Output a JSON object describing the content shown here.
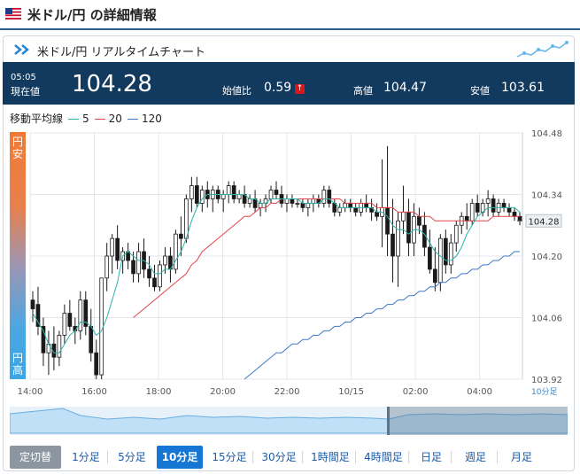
{
  "header": {
    "title": "米ドル/円 の詳細情報",
    "flag_icon": "us-flag-icon"
  },
  "panel": {
    "title": "米ドル/円 リアルタイムチャート"
  },
  "quote": {
    "time": "05:05",
    "time_label": "現在値",
    "price": "104.28",
    "change_label": "始値比",
    "change": "0.59",
    "high_label": "高値",
    "high": "104.47",
    "low_label": "安値",
    "low": "103.61"
  },
  "side": {
    "top": "円安",
    "bottom": "円高"
  },
  "legend": {
    "label": "移動平均線",
    "items": [
      {
        "label": "5",
        "color": "#2ab3a6"
      },
      {
        "label": "20",
        "color": "#e0444a"
      },
      {
        "label": "120",
        "color": "#3a79c9"
      }
    ]
  },
  "chart_data": {
    "type": "candlestick",
    "x_ticks": [
      "14:00",
      "16:00",
      "18:00",
      "20:00",
      "22:00",
      "10/15",
      "02:00",
      "04:00"
    ],
    "x_unit": "10分足",
    "ylim": [
      103.92,
      104.48
    ],
    "y_ticks": [
      "104.48",
      "104.34",
      "104.20",
      "104.06",
      "103.92"
    ],
    "current_price_label": "104.28",
    "grid": true,
    "colors": {
      "up": "#ffffff",
      "down": "#1a1a1a",
      "ma5": "#2ab3a6",
      "ma20": "#e0444a",
      "ma120": "#3a79c9"
    },
    "candles": [
      [
        104.1,
        104.12,
        104.05,
        104.08
      ],
      [
        104.09,
        104.13,
        104.02,
        104.04
      ],
      [
        104.04,
        104.06,
        103.95,
        103.98
      ],
      [
        103.98,
        104.03,
        103.93,
        104.0
      ],
      [
        104.0,
        104.04,
        103.94,
        103.97
      ],
      [
        103.97,
        104.03,
        103.95,
        104.02
      ],
      [
        104.02,
        104.09,
        104.0,
        104.07
      ],
      [
        104.07,
        104.1,
        104.03,
        104.04
      ],
      [
        104.04,
        104.06,
        104.0,
        104.03
      ],
      [
        104.03,
        104.12,
        104.01,
        104.1
      ],
      [
        104.1,
        104.12,
        104.02,
        104.04
      ],
      [
        104.04,
        104.08,
        103.96,
        103.98
      ],
      [
        103.98,
        104.01,
        103.92,
        103.93
      ],
      [
        103.93,
        104.15,
        103.92,
        104.15
      ],
      [
        104.15,
        104.23,
        104.12,
        104.2
      ],
      [
        104.2,
        104.25,
        104.16,
        104.24
      ],
      [
        104.24,
        104.27,
        104.17,
        104.19
      ],
      [
        104.19,
        104.22,
        104.16,
        104.21
      ],
      [
        104.21,
        104.23,
        104.17,
        104.19
      ],
      [
        104.19,
        104.21,
        104.14,
        104.16
      ],
      [
        104.16,
        104.23,
        104.14,
        104.21
      ],
      [
        104.21,
        104.24,
        104.15,
        104.17
      ],
      [
        104.17,
        104.2,
        104.13,
        104.15
      ],
      [
        104.15,
        104.18,
        104.12,
        104.13
      ],
      [
        104.13,
        104.19,
        104.12,
        104.18
      ],
      [
        104.18,
        104.22,
        104.16,
        104.2
      ],
      [
        104.2,
        104.22,
        104.14,
        104.17
      ],
      [
        104.17,
        104.26,
        104.16,
        104.25
      ],
      [
        104.25,
        104.29,
        104.2,
        104.24
      ],
      [
        104.24,
        104.34,
        104.23,
        104.33
      ],
      [
        104.33,
        104.38,
        104.3,
        104.36
      ],
      [
        104.36,
        104.38,
        104.31,
        104.32
      ],
      [
        104.32,
        104.36,
        104.3,
        104.35
      ],
      [
        104.35,
        104.37,
        104.31,
        104.33
      ],
      [
        104.33,
        104.36,
        104.3,
        104.35
      ],
      [
        104.35,
        104.36,
        104.32,
        104.33
      ],
      [
        104.33,
        104.35,
        104.3,
        104.34
      ],
      [
        104.34,
        104.37,
        104.32,
        104.36
      ],
      [
        104.36,
        104.37,
        104.32,
        104.33
      ],
      [
        104.33,
        104.35,
        104.32,
        104.34
      ],
      [
        104.34,
        104.36,
        104.31,
        104.32
      ],
      [
        104.32,
        104.34,
        104.31,
        104.33
      ],
      [
        104.33,
        104.35,
        104.3,
        104.31
      ],
      [
        104.31,
        104.33,
        104.29,
        104.32
      ],
      [
        104.32,
        104.34,
        104.3,
        104.33
      ],
      [
        104.33,
        104.36,
        104.32,
        104.35
      ],
      [
        104.35,
        104.37,
        104.33,
        104.34
      ],
      [
        104.34,
        104.36,
        104.31,
        104.32
      ],
      [
        104.32,
        104.34,
        104.3,
        104.33
      ],
      [
        104.33,
        104.34,
        104.31,
        104.32
      ],
      [
        104.32,
        104.33,
        104.31,
        104.32
      ],
      [
        104.32,
        104.33,
        104.3,
        104.31
      ],
      [
        104.31,
        104.33,
        104.29,
        104.32
      ],
      [
        104.32,
        104.34,
        104.3,
        104.33
      ],
      [
        104.33,
        104.34,
        104.31,
        104.32
      ],
      [
        104.32,
        104.36,
        104.31,
        104.35
      ],
      [
        104.35,
        104.36,
        104.31,
        104.32
      ],
      [
        104.32,
        104.33,
        104.29,
        104.3
      ],
      [
        104.3,
        104.32,
        104.29,
        104.31
      ],
      [
        104.31,
        104.33,
        104.3,
        104.32
      ],
      [
        104.32,
        104.33,
        104.3,
        104.31
      ],
      [
        104.31,
        104.32,
        104.29,
        104.3
      ],
      [
        104.3,
        104.33,
        104.29,
        104.32
      ],
      [
        104.32,
        104.34,
        104.3,
        104.31
      ],
      [
        104.31,
        104.33,
        104.28,
        104.3
      ],
      [
        104.3,
        104.32,
        104.28,
        104.29
      ],
      [
        104.29,
        104.42,
        104.22,
        104.31
      ],
      [
        104.31,
        104.45,
        104.2,
        104.25
      ],
      [
        104.25,
        104.33,
        104.14,
        104.2
      ],
      [
        104.2,
        104.3,
        104.13,
        104.28
      ],
      [
        104.28,
        104.36,
        104.25,
        104.3
      ],
      [
        104.3,
        104.33,
        104.2,
        104.23
      ],
      [
        104.23,
        104.32,
        104.2,
        104.29
      ],
      [
        104.29,
        104.31,
        104.25,
        104.27
      ],
      [
        104.27,
        104.3,
        104.2,
        104.22
      ],
      [
        104.22,
        104.26,
        104.16,
        104.17
      ],
      [
        104.17,
        104.22,
        104.12,
        104.14
      ],
      [
        104.14,
        104.25,
        104.12,
        104.24
      ],
      [
        104.24,
        104.26,
        104.16,
        104.18
      ],
      [
        104.18,
        104.25,
        104.16,
        104.23
      ],
      [
        104.23,
        104.28,
        104.21,
        104.27
      ],
      [
        104.27,
        104.3,
        104.25,
        104.29
      ],
      [
        104.29,
        104.32,
        104.26,
        104.28
      ],
      [
        104.28,
        104.33,
        104.27,
        104.32
      ],
      [
        104.32,
        104.34,
        104.29,
        104.3
      ],
      [
        104.3,
        104.33,
        104.29,
        104.32
      ],
      [
        104.32,
        104.35,
        104.29,
        104.33
      ],
      [
        104.33,
        104.34,
        104.29,
        104.3
      ],
      [
        104.3,
        104.33,
        104.29,
        104.32
      ],
      [
        104.32,
        104.33,
        104.3,
        104.31
      ],
      [
        104.31,
        104.32,
        104.29,
        104.3
      ],
      [
        104.3,
        104.31,
        104.28,
        104.29
      ],
      [
        104.29,
        104.3,
        104.27,
        104.28
      ]
    ],
    "ma5": [
      104.07,
      104.05,
      104.03,
      104.0,
      103.98,
      103.98,
      104.0,
      104.02,
      104.03,
      104.05,
      104.05,
      104.04,
      104.02,
      104.03,
      104.06,
      104.1,
      104.14,
      104.2,
      104.21,
      104.2,
      104.19,
      104.19,
      104.18,
      104.16,
      104.16,
      104.17,
      104.17,
      104.19,
      104.21,
      104.24,
      104.28,
      104.31,
      104.33,
      104.34,
      104.34,
      104.34,
      104.34,
      104.34,
      104.34,
      104.34,
      104.34,
      104.33,
      104.33,
      104.32,
      104.32,
      104.33,
      104.33,
      104.33,
      104.33,
      104.33,
      104.33,
      104.32,
      104.32,
      104.32,
      104.32,
      104.33,
      104.33,
      104.32,
      104.31,
      104.31,
      104.31,
      104.31,
      104.31,
      104.31,
      104.31,
      104.3,
      104.3,
      104.29,
      104.27,
      104.26,
      104.26,
      104.25,
      104.26,
      104.26,
      104.25,
      104.23,
      104.21,
      104.2,
      104.19,
      104.19,
      104.2,
      104.22,
      104.25,
      104.27,
      104.29,
      104.3,
      104.31,
      104.31,
      104.31,
      104.31,
      104.31,
      104.31,
      104.3
    ],
    "ma20": [
      null,
      null,
      null,
      null,
      null,
      null,
      null,
      null,
      null,
      null,
      null,
      null,
      null,
      null,
      null,
      null,
      null,
      null,
      null,
      104.06,
      104.07,
      104.08,
      104.09,
      104.1,
      104.11,
      104.12,
      104.13,
      104.14,
      104.15,
      104.16,
      104.18,
      104.19,
      104.21,
      104.22,
      104.23,
      104.24,
      104.25,
      104.26,
      104.27,
      104.28,
      104.29,
      104.29,
      104.3,
      104.31,
      104.31,
      104.32,
      104.32,
      104.33,
      104.33,
      104.33,
      104.33,
      104.33,
      104.33,
      104.33,
      104.33,
      104.33,
      104.33,
      104.33,
      104.33,
      104.32,
      104.32,
      104.32,
      104.32,
      104.32,
      104.32,
      104.31,
      104.31,
      104.31,
      104.31,
      104.3,
      104.3,
      104.3,
      104.3,
      104.29,
      104.29,
      104.29,
      104.28,
      104.28,
      104.28,
      104.28,
      104.28,
      104.28,
      104.28,
      104.28,
      104.28,
      104.28,
      104.28,
      104.29,
      104.29,
      104.29,
      104.29,
      104.29,
      104.29
    ],
    "ma120": [
      null,
      null,
      null,
      null,
      null,
      null,
      null,
      null,
      null,
      null,
      null,
      null,
      null,
      null,
      null,
      null,
      null,
      null,
      null,
      null,
      null,
      null,
      null,
      null,
      null,
      null,
      null,
      null,
      null,
      null,
      null,
      null,
      null,
      null,
      null,
      null,
      null,
      null,
      null,
      null,
      103.92,
      103.93,
      103.94,
      103.95,
      103.96,
      103.97,
      103.98,
      103.98,
      103.99,
      104.0,
      104.0,
      104.01,
      104.01,
      104.02,
      104.02,
      104.03,
      104.03,
      104.04,
      104.04,
      104.05,
      104.05,
      104.06,
      104.06,
      104.07,
      104.07,
      104.08,
      104.08,
      104.09,
      104.09,
      104.1,
      104.1,
      104.11,
      104.11,
      104.12,
      104.12,
      104.13,
      104.13,
      104.14,
      104.14,
      104.15,
      104.15,
      104.16,
      104.16,
      104.17,
      104.17,
      104.18,
      104.18,
      104.19,
      104.19,
      104.2,
      104.2,
      104.21,
      104.21
    ]
  },
  "tabs": [
    {
      "label": "定切替",
      "name": "tab-toggle",
      "kind": "toggle"
    },
    {
      "label": "1分足",
      "name": "tab-1min"
    },
    {
      "label": "5分足",
      "name": "tab-5min"
    },
    {
      "label": "10分足",
      "name": "tab-10min",
      "kind": "active"
    },
    {
      "label": "15分足",
      "name": "tab-15min"
    },
    {
      "label": "30分足",
      "name": "tab-30min"
    },
    {
      "label": "1時間足",
      "name": "tab-1hour"
    },
    {
      "label": "4時間足",
      "name": "tab-4hour"
    },
    {
      "label": "日足",
      "name": "tab-daily"
    },
    {
      "label": "週足",
      "name": "tab-weekly"
    },
    {
      "label": "月足",
      "name": "tab-monthly"
    }
  ]
}
